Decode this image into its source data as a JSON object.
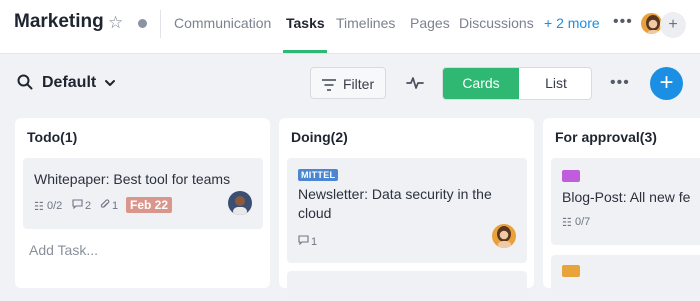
{
  "header": {
    "project_title": "Marketing",
    "tabs": [
      "Communication",
      "Tasks",
      "Timelines",
      "Pages",
      "Discussions"
    ],
    "more_tabs": "+ 2 more",
    "active_tab": "Tasks"
  },
  "toolbar": {
    "view_name": "Default",
    "filter_label": "Filter",
    "view_modes": [
      "Cards",
      "List"
    ],
    "active_mode": "Cards"
  },
  "columns": [
    {
      "title": "Todo(1)",
      "cards": [
        {
          "title": "Whitepaper: Best tool for teams",
          "checklist": "0/2",
          "comments": "2",
          "attachments": "1",
          "due": "Feb 22"
        }
      ],
      "add_task": "Add Task..."
    },
    {
      "title": "Doing(2)",
      "cards": [
        {
          "tag": "MITTEL",
          "title_line1": "Newsletter: Data security in the",
          "title_line2": "cloud",
          "comments": "1"
        }
      ]
    },
    {
      "title": "For approval(3)",
      "cards": [
        {
          "title": "Blog-Post: All new fe",
          "checklist": "0/7"
        }
      ]
    }
  ],
  "colors": {
    "accent_green": "#2eb872",
    "accent_blue": "#1a8fe3",
    "date_badge": "#d9968c",
    "tag_blue": "#4a86d1",
    "chip_purple": "#c05ddc",
    "chip_orange": "#e8a33a"
  }
}
